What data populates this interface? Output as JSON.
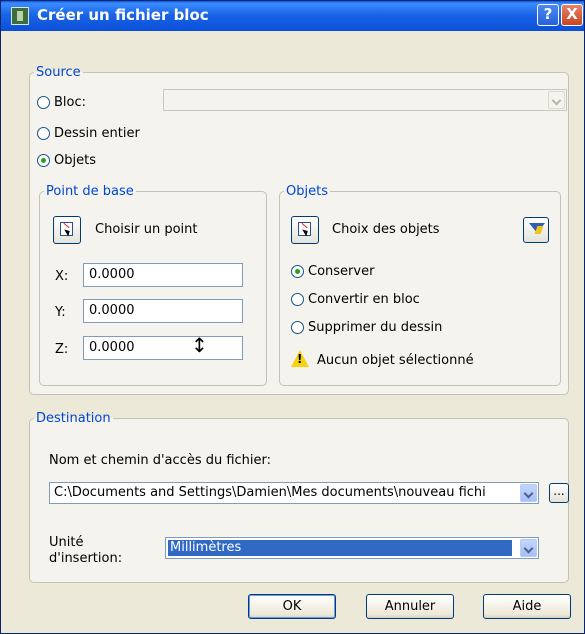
{
  "window": {
    "title": "Créer un fichier bloc",
    "help_label": "?",
    "close_label": "X"
  },
  "source": {
    "legend": "Source",
    "bloc_label": "Bloc:",
    "dessin_label": "Dessin entier",
    "objets_label": "Objets",
    "selected": "Objets"
  },
  "base_point": {
    "legend": "Point de base",
    "pick_label": "Choisir un point",
    "x_label": "X:",
    "y_label": "Y:",
    "z_label": "Z:",
    "x_value": "0.0000",
    "y_value": "0.0000",
    "z_value": "0.0000"
  },
  "objects": {
    "legend": "Objets",
    "select_label": "Choix des objets",
    "conserver_label": "Conserver",
    "convertir_label": "Convertir en bloc",
    "supprimer_label": "Supprimer du dessin",
    "selected": "Conserver",
    "warning_text": "Aucun objet sélectionné"
  },
  "destination": {
    "legend": "Destination",
    "path_label": "Nom et chemin d'accès du fichier:",
    "path_value": "C:\\Documents and Settings\\Damien\\Mes documents\\nouveau fichi",
    "browse_label": "...",
    "unit_label_1": "Unité",
    "unit_label_2": "d'insertion:",
    "unit_value": "Millimètres"
  },
  "buttons": {
    "ok": "OK",
    "cancel": "Annuler",
    "help": "Aide"
  },
  "colors": {
    "legend_blue": "#0046d5",
    "title_blue": "#0a5ae8",
    "selection_blue": "#316ac5"
  }
}
